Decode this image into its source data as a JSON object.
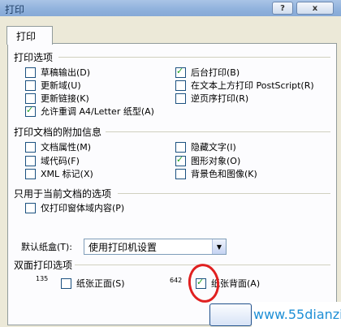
{
  "window": {
    "title": "打印",
    "help_button": "?",
    "close_button": "x"
  },
  "tab": {
    "label": "打印"
  },
  "sections": {
    "print_options": {
      "title": "打印选项",
      "left": [
        {
          "label": "草稿输出(D)",
          "checked": false
        },
        {
          "label": "更新域(U)",
          "checked": false
        },
        {
          "label": "更新链接(K)",
          "checked": false
        },
        {
          "label": "允许重调 A4/Letter 纸型(A)",
          "checked": true
        }
      ],
      "right": [
        {
          "label": "后台打印(B)",
          "checked": true
        },
        {
          "label": "在文本上方打印 PostScript(R)",
          "checked": false
        },
        {
          "label": "逆页序打印(R)",
          "checked": false
        }
      ]
    },
    "include_with_document": {
      "title": "打印文档的附加信息",
      "left": [
        {
          "label": "文档属性(M)",
          "checked": false
        },
        {
          "label": "域代码(F)",
          "checked": false
        },
        {
          "label": "XML 标记(X)",
          "checked": false
        }
      ],
      "right": [
        {
          "label": "隐藏文字(I)",
          "checked": false
        },
        {
          "label": "图形对象(O)",
          "checked": true
        },
        {
          "label": "背景色和图像(K)",
          "checked": false
        }
      ]
    },
    "current_document": {
      "title": "只用于当前文档的选项",
      "options": [
        {
          "label": "仅打印窗体域内容(P)",
          "checked": false
        }
      ]
    },
    "tray": {
      "label": "默认纸盒(T):",
      "value": "使用打印机设置"
    },
    "duplex": {
      "title": "双面打印选项",
      "front_icon": "135",
      "back_icon": "642",
      "front_label": "纸张正面(S)",
      "front_checked": false,
      "back_label": "纸张背面(A)",
      "back_checked": true
    }
  },
  "watermark": "www.55dianzi.com",
  "colors": {
    "title_bar": "#8fb1dc",
    "dialog_bg": "#ece9d8",
    "panel_bg": "#fcfcfe",
    "check": "#21a121",
    "annotation_circle": "#e02020",
    "watermark": "#1e8fd6"
  }
}
